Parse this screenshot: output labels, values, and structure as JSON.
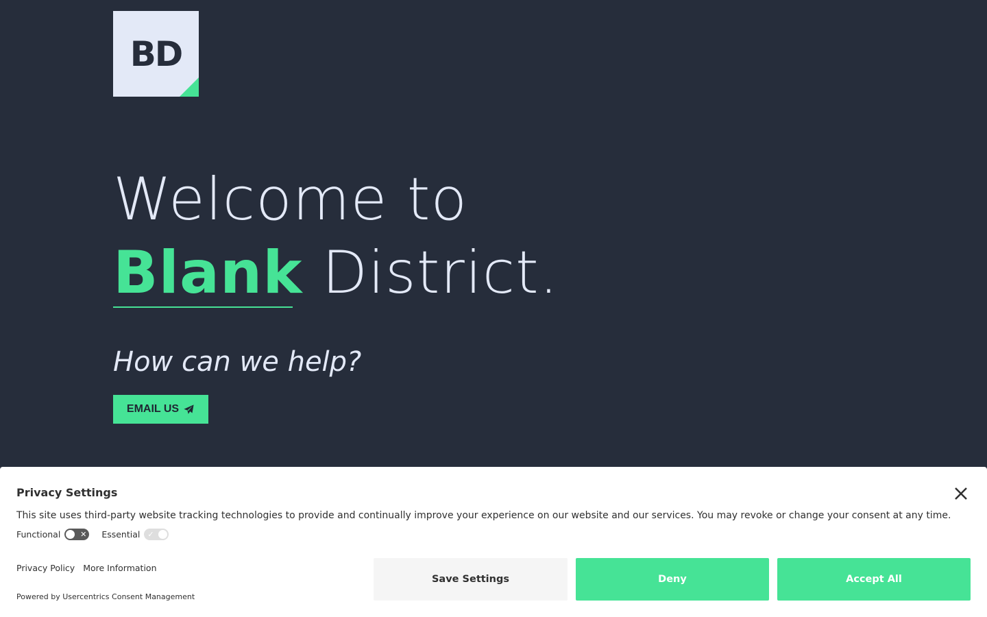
{
  "logo": {
    "text": "BD"
  },
  "hero": {
    "line1": "Welcome to",
    "accent_word": "Blank",
    "line2_rest": " District.",
    "tagline": "How can we help?"
  },
  "cta": {
    "email_label": "EMAIL US",
    "icon": "paper-plane-icon"
  },
  "colors": {
    "background": "#262d3b",
    "accent": "#46e396",
    "text_light": "#e3e9f7"
  },
  "privacy": {
    "title": "Privacy Settings",
    "description": "This site uses third-party website tracking technologies to provide and continually improve your experience on our website and our services. You may revoke or change your consent at any time.",
    "toggles": [
      {
        "label": "Functional",
        "state": "off"
      },
      {
        "label": "Essential",
        "state": "on"
      }
    ],
    "links": {
      "privacy_policy": "Privacy Policy",
      "more_info": "More Information"
    },
    "powered_by": "Powered by Usercentrics Consent Management",
    "buttons": {
      "save": "Save Settings",
      "deny": "Deny",
      "accept": "Accept All"
    }
  }
}
